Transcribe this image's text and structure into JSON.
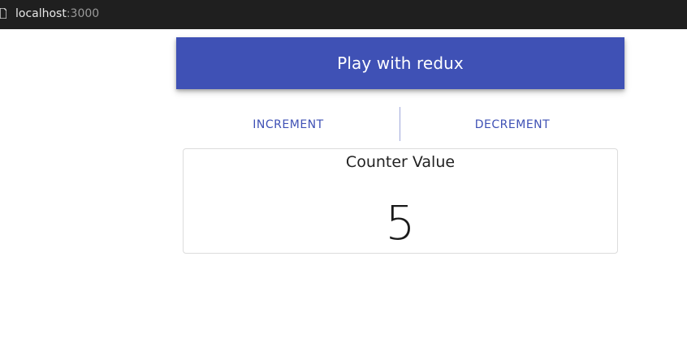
{
  "browser": {
    "url_host": "localhost",
    "url_port": ":3000",
    "page_icon": "page-icon"
  },
  "app_bar": {
    "title": "Play with redux",
    "color": "#3f51b5"
  },
  "actions": {
    "increment_label": "INCREMENT",
    "decrement_label": "DECREMENT"
  },
  "counter": {
    "title": "Counter Value",
    "value": "5"
  }
}
